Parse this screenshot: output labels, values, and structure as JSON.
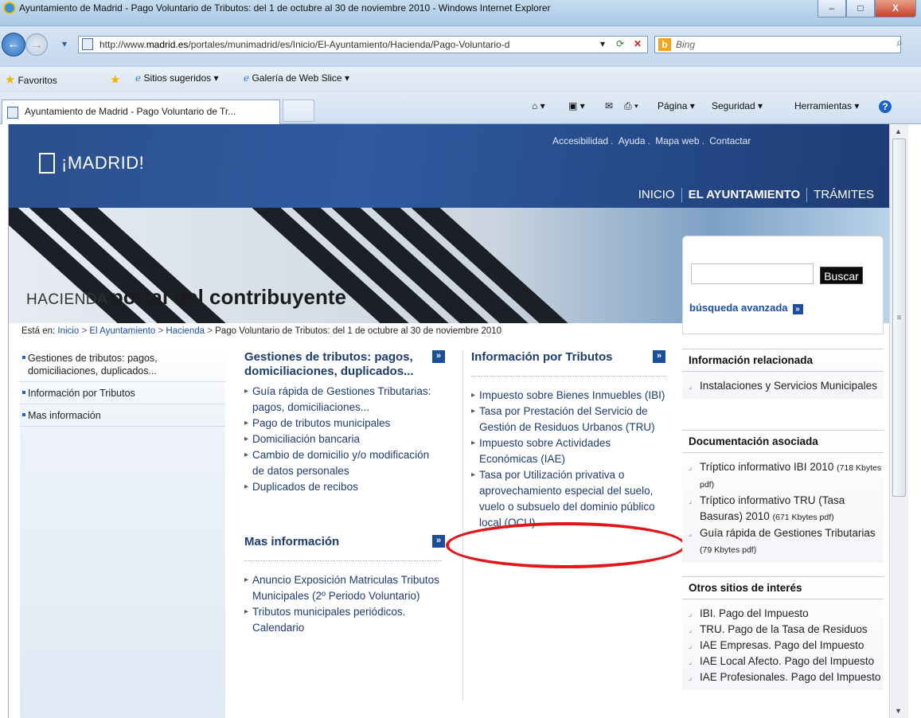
{
  "window": {
    "title": "Ayuntamiento de Madrid - Pago Voluntario de Tributos: del 1 de octubre al 30 de noviembre 2010 - Windows Internet Explorer",
    "minimize": "–",
    "maximize": "□",
    "close": "X"
  },
  "addressbar": {
    "url_prefix": "http://www.",
    "url_domain": "madrid.es",
    "url_rest": "/portales/munimadrid/es/Inicio/El-Ayuntamiento/Hacienda/Pago-Voluntario-d",
    "search_placeholder": "Bing",
    "bing_label": "b"
  },
  "favorites": {
    "favoritos": "Favoritos",
    "sitios": "Sitios sugeridos ▾",
    "galeria": "Galería de Web Slice ▾"
  },
  "tabs": {
    "active": "Ayuntamiento de Madrid - Pago Voluntario de Tr...",
    "pagina": "Página ▾",
    "seguridad": "Seguridad ▾",
    "herramientas": "Herramientas ▾",
    "help": "?"
  },
  "header": {
    "logo_text": "¡MADRID!",
    "top_links": [
      "Accesibilidad",
      "Ayuda",
      "Mapa web",
      "Contactar"
    ],
    "nav": [
      "INICIO",
      "EL AYUNTAMIENTO",
      "TRÁMITES"
    ]
  },
  "portal": {
    "section": "HACIENDA",
    "title": "portal del contribuyente"
  },
  "search": {
    "button": "Buscar",
    "advanced": "búsqueda avanzada"
  },
  "breadcrumb": {
    "prefix": "Está en:",
    "items": [
      "Inicio",
      "El Ayuntamiento",
      "Hacienda"
    ],
    "current": "Pago Voluntario de Tributos: del 1 de octubre al 30 de noviembre 2010"
  },
  "leftnav": [
    "Gestiones de tributos: pagos, domiciliaciones, duplicados...",
    "Información por Tributos",
    "Mas información"
  ],
  "gestiones": {
    "title": "Gestiones de tributos: pagos, domiciliaciones, duplicados...",
    "links": [
      "Guía rápida de Gestiones Tributarias: pagos, domiciliaciones...",
      "Pago de tributos municipales",
      "Domiciliación bancaria",
      "Cambio de domicilio y/o modificación de datos personales",
      "Duplicados de recibos"
    ]
  },
  "masinfo": {
    "title": "Mas información",
    "links": [
      "Anuncio Exposición Matriculas Tributos Municipales (2º Periodo Voluntario)",
      "Tributos municipales periódicos. Calendario"
    ]
  },
  "infotributos": {
    "title": "Información por Tributos",
    "links": [
      "Impuesto sobre Bienes Inmuebles (IBI)",
      "Tasa por Prestación del Servicio de Gestión de Residuos Urbanos (TRU)",
      "Impuesto sobre Actividades Económicas (IAE)",
      "Tasa por Utilización privativa o aprovechamiento especial del suelo, vuelo o subsuelo del dominio público local (OCU)"
    ]
  },
  "related": {
    "title": "Información relacionada",
    "links": [
      "Instalaciones y Servicios Municipales"
    ]
  },
  "docs": {
    "title": "Documentación asociada",
    "items": [
      {
        "text": "Tríptico informativo IBI 2010",
        "size": "(718 Kbytes pdf)"
      },
      {
        "text": "Tríptico informativo TRU (Tasa Basuras) 2010",
        "size": "(671 Kbytes pdf)"
      },
      {
        "text": "Guía rápida de Gestiones Tributarias",
        "size": "(79 Kbytes pdf)"
      }
    ]
  },
  "otros": {
    "title": "Otros sitios de interés",
    "links": [
      "IBI. Pago del Impuesto",
      "TRU. Pago de la Tasa de Residuos",
      "IAE Empresas. Pago del Impuesto",
      "IAE Local Afecto. Pago del Impuesto",
      "IAE Profesionales. Pago del Impuesto"
    ]
  },
  "colors": {
    "header_blue": "#2f5aa0",
    "link_blue": "#1d3c6e",
    "highlight_red": "#e0161b"
  }
}
